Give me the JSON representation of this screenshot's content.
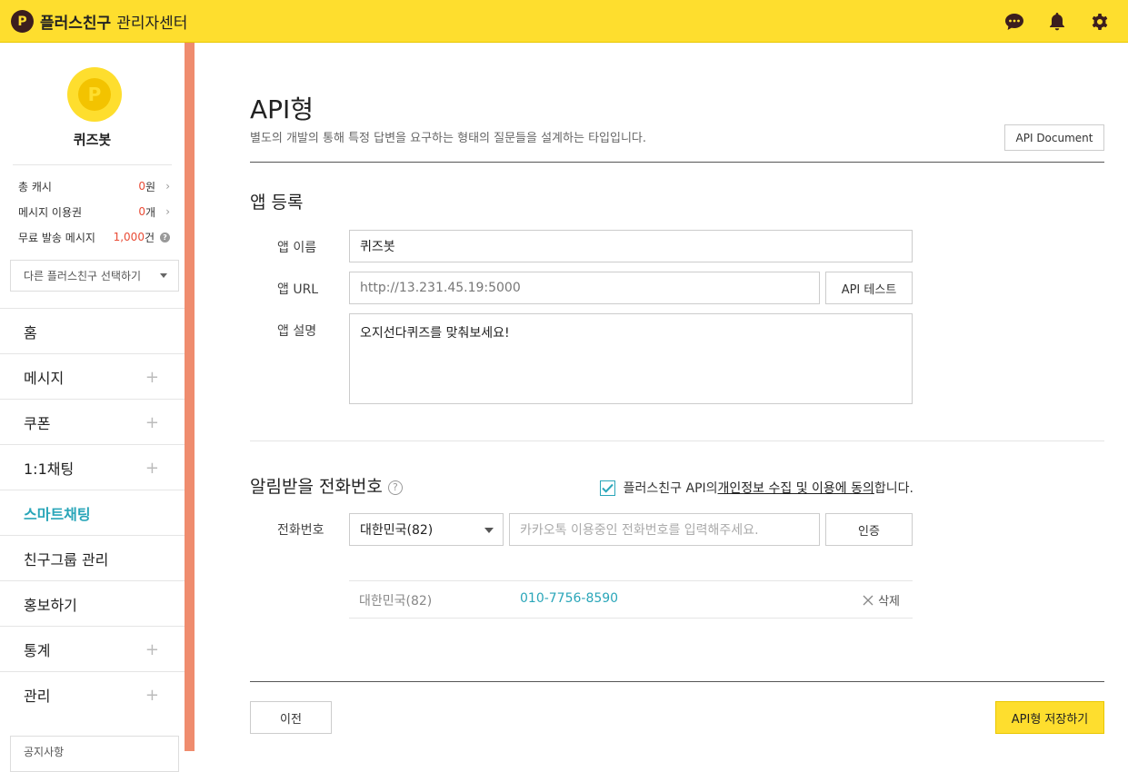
{
  "header": {
    "logo_letter": "P",
    "brand": "플러스친구",
    "subtitle": "관리자센터",
    "icons": [
      "chat-icon",
      "bell-icon",
      "gear-icon"
    ],
    "accent_color": "#fede2e"
  },
  "sidebar": {
    "avatar_letter": "P",
    "profile_name": "퀴즈봇",
    "stats": [
      {
        "label": "총 캐시",
        "value": "0",
        "unit": "원"
      },
      {
        "label": "메시지 이용권",
        "value": "0",
        "unit": "개"
      },
      {
        "label": "무료 발송 메시지",
        "value": "1,000",
        "unit": "건"
      }
    ],
    "friend_select_label": "다른 플러스친구 선택하기",
    "nav": [
      {
        "label": "홈",
        "expandable": false
      },
      {
        "label": "메시지",
        "expandable": true
      },
      {
        "label": "쿠폰",
        "expandable": true
      },
      {
        "label": "1:1채팅",
        "expandable": true
      },
      {
        "label": "스마트채팅",
        "expandable": false,
        "active": true
      },
      {
        "label": "친구그룹 관리",
        "expandable": false
      },
      {
        "label": "홍보하기",
        "expandable": false
      },
      {
        "label": "통계",
        "expandable": true
      },
      {
        "label": "관리",
        "expandable": true
      }
    ],
    "notice_label": "공지사항",
    "active_color": "#2aa6b9",
    "edge_color": "#ef8c6e"
  },
  "main": {
    "title": "API형",
    "description": "별도의 개발의 통해 특정 답변을 요구하는 형태의 질문들을 설계하는 타입입니다.",
    "doc_button": "API Document",
    "app_section": {
      "title": "앱 등록",
      "name_label": "앱 이름",
      "name_value": "퀴즈봇",
      "url_label": "앱 URL",
      "url_value": "http://13.231.45.19:5000",
      "api_test_button": "API 테스트",
      "desc_label": "앱 설명",
      "desc_value": "오지선다퀴즈를 맞춰보세요!"
    },
    "phone_section": {
      "title": "알림받을 전화번호",
      "help_glyph": "?",
      "agree_prefix": "플러스친구 API의 ",
      "agree_link": "개인정보 수집 및 이용에 동의",
      "agree_suffix": "합니다.",
      "agree_checked": true,
      "phone_label": "전화번호",
      "country_select": "대한민국(82)",
      "phone_placeholder": "카카오톡 이용중인 전화번호를 입력해주세요.",
      "verify_button": "인증",
      "registered": {
        "country": "대한민국(82)",
        "number": "010-7756-8590",
        "delete_label": "삭제"
      }
    },
    "prev_button": "이전",
    "save_button": "API형 저장하기"
  }
}
